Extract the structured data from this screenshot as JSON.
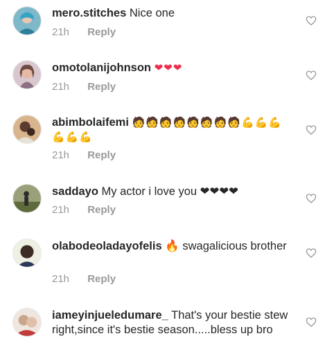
{
  "comments": [
    {
      "username": "mero.stitches",
      "text": "Nice one",
      "time": "21h",
      "reply": "Reply",
      "avatar_color": "#7fb8c8"
    },
    {
      "username": "omotolanijohnson",
      "text": "❤❤❤",
      "time": "21h",
      "reply": "Reply",
      "avatar_color": "#b59ba8"
    },
    {
      "username": "abimbolaifemi",
      "text": "🧑🧑🧑🧑🧑🧑🧑🧑💪💪💪 💪💪💪",
      "time": "21h",
      "reply": "Reply",
      "avatar_color": "#5b3c2e"
    },
    {
      "username": "saddayo",
      "text": "My actor i love you ❤❤❤❤",
      "time": "21h",
      "reply": "Reply",
      "avatar_color": "#6e7a4e"
    },
    {
      "username": "olabodeoladayofelis",
      "text": "🔥 swagalicious brother",
      "time": "21h",
      "reply": "Reply",
      "avatar_color": "#3b2d25"
    },
    {
      "username": "iameyinjueledumare_",
      "text": "That's your bestie stew right,since it's bestie season.....bless up bro",
      "time": "",
      "reply": "",
      "avatar_color": "#c9a58a"
    }
  ],
  "icons": {
    "like": "heart-outline-icon"
  },
  "colors": {
    "meta_text": "#999999",
    "text": "#262626",
    "heart_emoji": "#ed2d49"
  }
}
